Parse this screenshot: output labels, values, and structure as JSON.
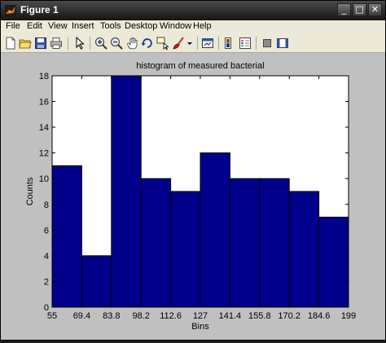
{
  "window": {
    "title": "Figure 1",
    "controls": {
      "minimize": "_",
      "maximize": "□",
      "close": "✕"
    }
  },
  "menubar": {
    "items": [
      "File",
      "Edit",
      "View",
      "Insert",
      "Tools",
      "Desktop",
      "Window",
      "Help"
    ]
  },
  "toolbar": {
    "icons": [
      "new-figure-icon",
      "open-file-icon",
      "save-icon",
      "print-icon",
      "edit-plot-arrow-icon",
      "zoom-in-icon",
      "zoom-out-icon",
      "pan-icon",
      "rotate-3d-icon",
      "data-cursor-icon",
      "brush-icon",
      "link-plot-icon",
      "insert-colorbar-icon",
      "insert-legend-icon",
      "hide-plot-tools-icon",
      "show-plot-tools-icon"
    ]
  },
  "colors": {
    "bar_fill": "#00008b",
    "bar_edge": "#000000",
    "axes_bg": "#ffffff",
    "figure_bg": "#c0c0c0"
  },
  "chart_data": {
    "type": "bar",
    "title": "histogram of measured bacterial",
    "xlabel": "Bins",
    "ylabel": "Counts",
    "x_tick_labels": [
      "55",
      "69.4",
      "83.8",
      "98.2",
      "112.6",
      "127",
      "141.4",
      "155.8",
      "170.2",
      "184.6",
      "199"
    ],
    "y_tick_labels": [
      "0",
      "2",
      "4",
      "6",
      "8",
      "10",
      "12",
      "14",
      "16",
      "18"
    ],
    "xlim": [
      55,
      199
    ],
    "ylim": [
      0,
      18
    ],
    "bin_edges": [
      55,
      69.4,
      83.8,
      98.2,
      112.6,
      127,
      141.4,
      155.8,
      170.2,
      184.6,
      199
    ],
    "values": [
      11,
      4,
      18,
      10,
      9,
      12,
      10,
      10,
      9,
      7
    ],
    "grid": false
  }
}
